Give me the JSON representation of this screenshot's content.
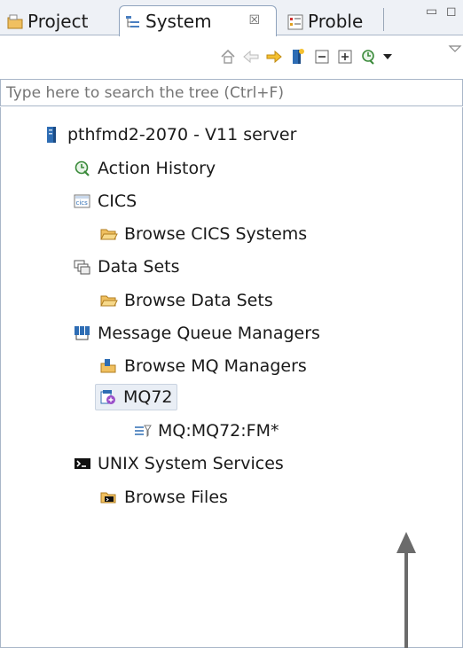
{
  "tabs": [
    {
      "label": "Project",
      "icon": "project-folder-icon"
    },
    {
      "label": "System",
      "icon": "system-tree-icon",
      "close_glyph": "☒"
    },
    {
      "label": "Proble",
      "icon": "problems-icon"
    }
  ],
  "window_controls": {
    "minimize": "▭",
    "maximize": "◻"
  },
  "toolbar": {
    "icons": [
      "home-icon",
      "back-arrow-icon",
      "forward-arrow-icon",
      "server-icon",
      "collapse-all-icon",
      "expand-all-icon",
      "run-history-icon",
      "dropdown-icon",
      "view-menu-icon"
    ]
  },
  "search": {
    "placeholder": "Type here to search the tree (Ctrl+F)"
  },
  "tree": {
    "root": {
      "label": "pthfmd2-2070 - V11 server",
      "icon": "server-icon"
    },
    "action_history": {
      "label": "Action History",
      "icon": "action-history-icon"
    },
    "cics": {
      "label": "CICS",
      "icon": "cics-icon"
    },
    "browse_cics": {
      "label": "Browse CICS Systems",
      "icon": "folder-open-icon"
    },
    "data_sets": {
      "label": "Data Sets",
      "icon": "data-sets-icon"
    },
    "browse_data_sets": {
      "label": "Browse Data Sets",
      "icon": "folder-open-icon"
    },
    "mq_managers": {
      "label": "Message Queue Managers",
      "icon": "mq-managers-icon"
    },
    "browse_mq": {
      "label": "Browse MQ Managers",
      "icon": "browse-mq-icon"
    },
    "mq72": {
      "label": "MQ72",
      "icon": "mq-manager-icon"
    },
    "mq72_filter": {
      "label": "MQ:MQ72:FM*",
      "icon": "queue-filter-icon"
    },
    "unix": {
      "label": "UNIX System Services",
      "icon": "terminal-icon"
    },
    "browse_files": {
      "label": "Browse Files",
      "icon": "browse-files-icon"
    }
  },
  "colors": {
    "accent": "#2e6db4",
    "tab_bg": "#eef1f6",
    "border": "#a9b6c8",
    "folder": "#f0b840"
  }
}
